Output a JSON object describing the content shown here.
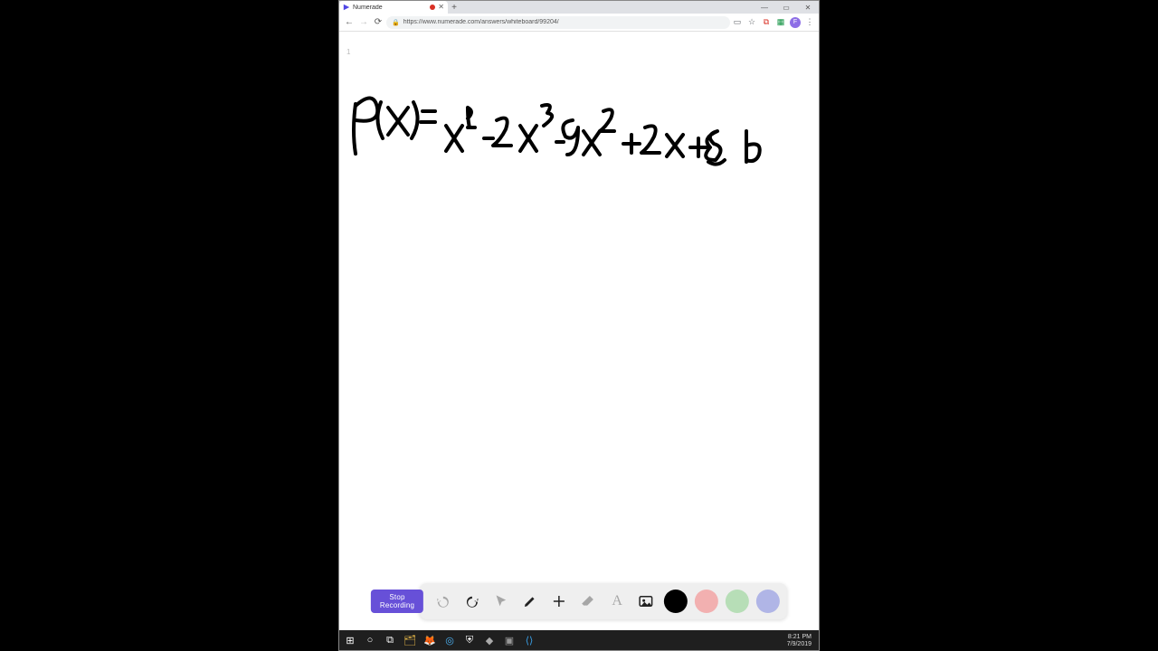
{
  "browser": {
    "tab": {
      "title": "Numerade",
      "recording": true
    },
    "window_controls": {
      "min": "—",
      "max": "▭",
      "close": "✕"
    },
    "nav": {
      "back": "←",
      "forward": "→",
      "reload": "⟳"
    },
    "omnibox": {
      "lock": "🔒",
      "url": "https://www.numerade.com/answers/whiteboard/99204/"
    },
    "addr_icons": {
      "reader": "▭",
      "star": "☆",
      "ext": "⧉",
      "avatar": "F",
      "menu": "⋮"
    },
    "new_tab": "+"
  },
  "page": {
    "corner_hint": "1"
  },
  "whiteboard": {
    "handwriting_alt": "p(x) = x^4 - 2x^3 - 9x^2 + 2x + 8   b",
    "recording_button": "Stop Recording",
    "tools": {
      "undo": "↶",
      "redo": "↷",
      "pointer": "↖",
      "pen": "✎",
      "plus": "＋",
      "eraser": "⌫",
      "text": "A",
      "image": "🖼"
    },
    "colors": {
      "black": "#000000",
      "red": "#f2b0b0",
      "green": "#b7deb7",
      "blue": "#b0b5e6"
    }
  },
  "taskbar": {
    "icons": {
      "start": "⊞",
      "search": "○",
      "taskview": "⧉",
      "files": "🗂",
      "firefox": "🦊",
      "chrome": "◎",
      "shield": "⛨",
      "app1": "◆",
      "term": "▣",
      "vscode": "⟨⟩"
    },
    "time": "8:21 PM",
    "date": "7/9/2019"
  }
}
